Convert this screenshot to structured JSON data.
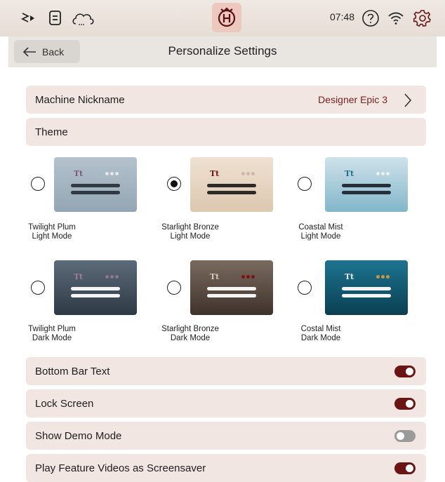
{
  "status_bar": {
    "time": "07:48",
    "icons": [
      "stitch-icon",
      "document-icon",
      "cloud-icon",
      "husqvarna-logo-icon",
      "help-icon",
      "wifi-icon",
      "settings-gear-icon"
    ]
  },
  "header": {
    "back_label": "Back",
    "title": "Personalize Settings"
  },
  "nickname_row": {
    "label": "Machine Nickname",
    "value": "Designer Epic 3"
  },
  "theme_header": "Theme",
  "themes": [
    {
      "line1": "Twilight Plum",
      "line2": "Light Mode",
      "selected": false
    },
    {
      "line1": "Starlight Bronze",
      "line2": "Light Mode",
      "selected": true
    },
    {
      "line1": "Coastal Mist",
      "line2": "Light Mode",
      "selected": false
    },
    {
      "line1": "Twilight Plum",
      "line2": "Dark Mode",
      "selected": false
    },
    {
      "line1": "Starlight Bronze",
      "line2": "Dark Mode",
      "selected": false
    },
    {
      "line1": "Costal Mist",
      "line2": "Dark Mode",
      "selected": false
    }
  ],
  "toggles": [
    {
      "label": "Bottom Bar Text",
      "on": true
    },
    {
      "label": "Lock Screen",
      "on": true
    },
    {
      "label": "Show Demo Mode",
      "on": false
    },
    {
      "label": "Play Feature Videos as Screensaver",
      "on": true
    }
  ],
  "colors": {
    "accent": "#6b1414",
    "row_background": "#f2e6e3",
    "nickname_value": "#7a1e1e"
  }
}
